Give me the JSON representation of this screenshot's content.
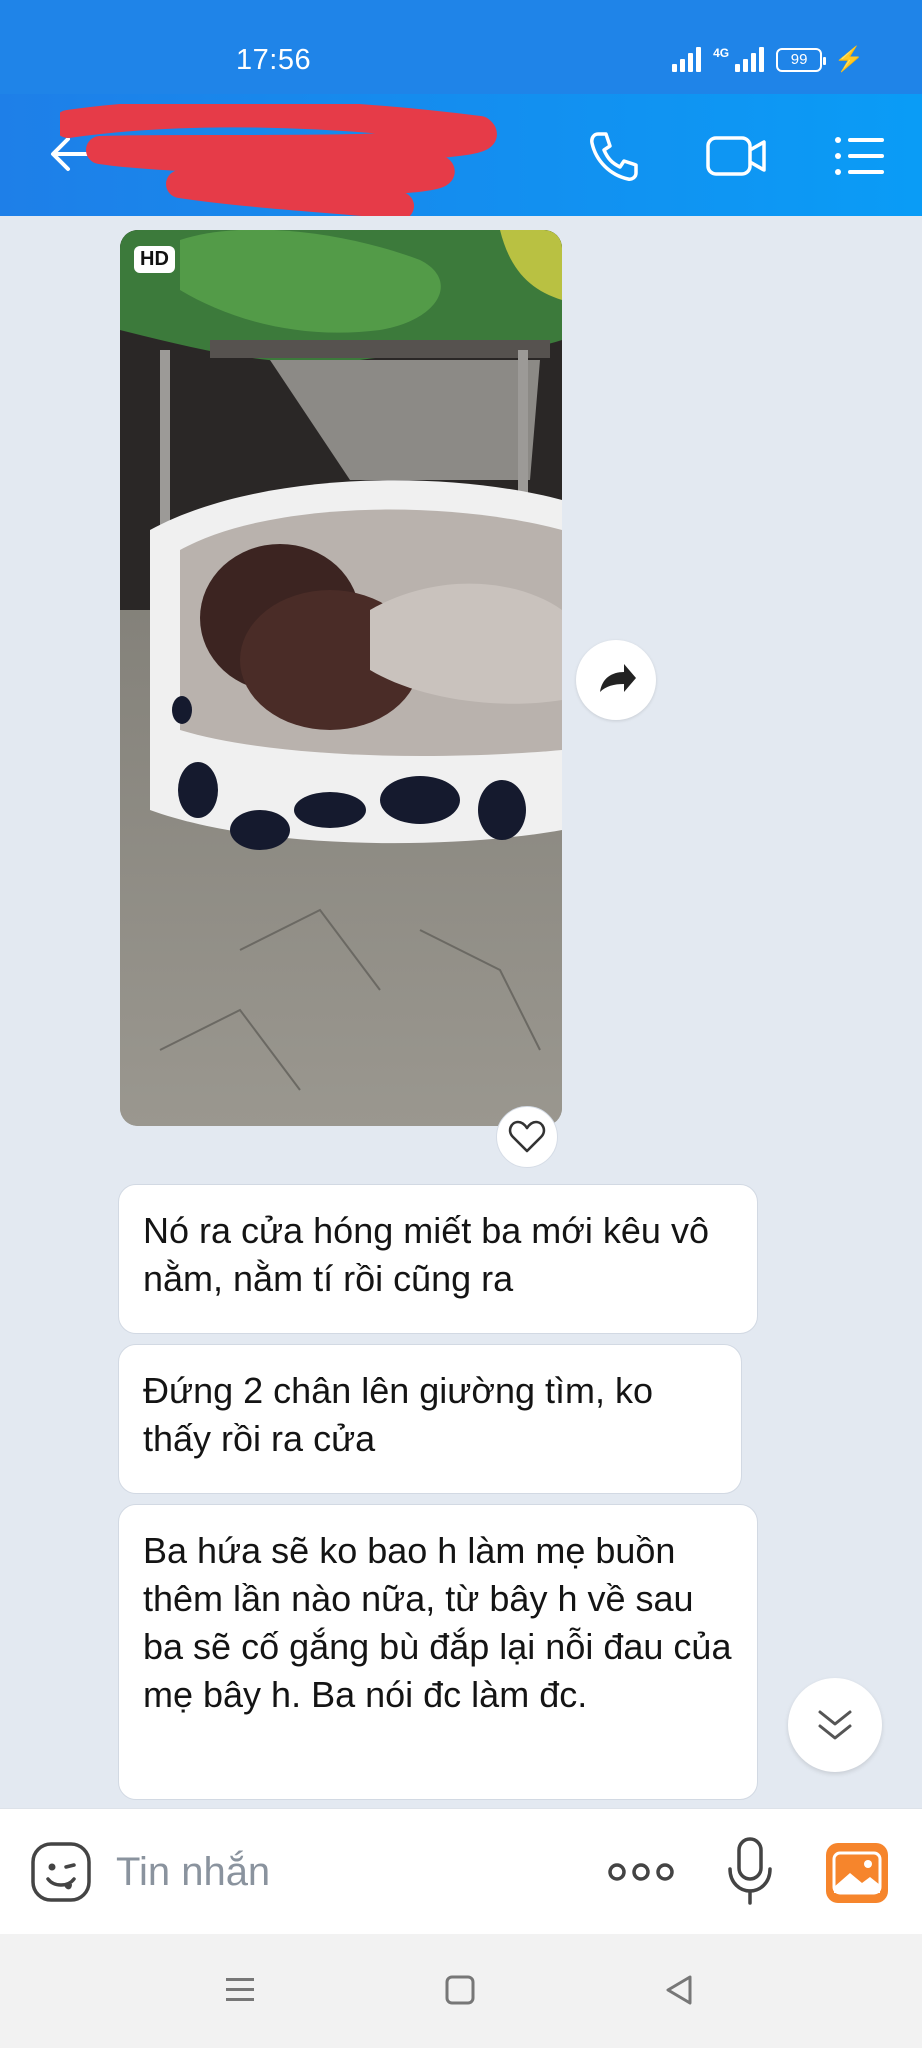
{
  "status_bar": {
    "time": "17:56",
    "network": "4G",
    "battery": "99"
  },
  "header": {
    "contact_name": "",
    "icons": {
      "back": "arrow-left-icon",
      "call": "phone-icon",
      "video": "video-camera-icon",
      "menu": "list-menu-icon"
    }
  },
  "conversation": {
    "photo": {
      "badge": "HD",
      "description_icon": "dog-photo"
    },
    "messages": [
      {
        "text": "Nó ra cửa hóng miết ba mới kêu vô nằm, nằm tí rồi cũng ra"
      },
      {
        "text": "Đứng 2 chân lên giường tìm, ko thấy rồi ra cửa"
      },
      {
        "text": "Ba hứa sẽ ko bao h làm mẹ buồn thêm lần nào nữa, từ bây h về sau ba sẽ cố gắng bù đắp lại nỗi đau của mẹ bây h. Ba nói đc làm đc."
      }
    ]
  },
  "composer": {
    "placeholder": "Tin nhắn",
    "icons": {
      "emoji": "emoji-icon",
      "more": "more-dots-icon",
      "mic": "microphone-icon",
      "gallery": "image-gallery-icon"
    }
  },
  "colors": {
    "header_start": "#1e7fe8",
    "header_end": "#0a9cf6",
    "chat_bg": "#e3e9f1",
    "gallery_accent": "#f6852c"
  }
}
